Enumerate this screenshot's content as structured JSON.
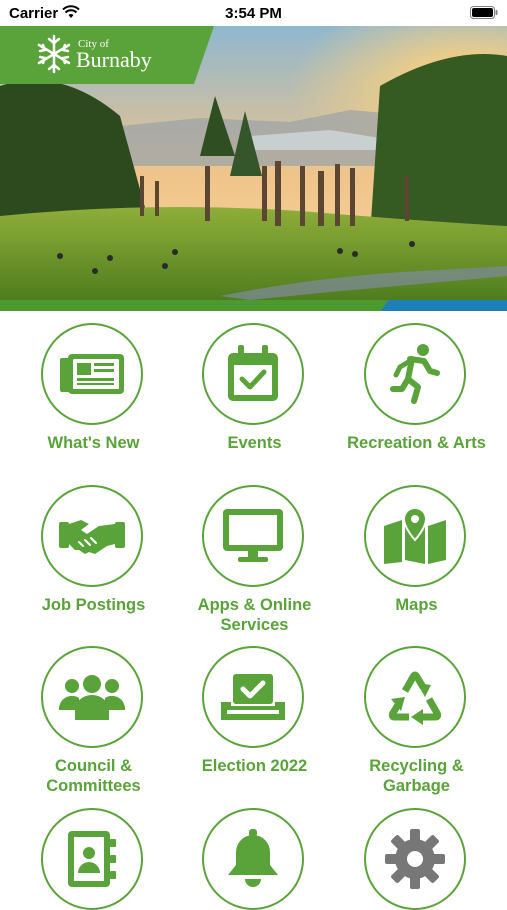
{
  "status_bar": {
    "carrier": "Carrier",
    "time": "3:54 PM"
  },
  "brand": {
    "city_of": "City of",
    "name": "Burnaby",
    "colors": {
      "green": "#5aa33a",
      "blue": "#1c7fb8"
    }
  },
  "tiles": [
    {
      "label": "What's New",
      "icon": "newspaper-icon"
    },
    {
      "label": "Events",
      "icon": "calendar-check-icon"
    },
    {
      "label": "Recreation & Arts",
      "icon": "running-person-icon"
    },
    {
      "label": "Job Postings",
      "icon": "handshake-icon"
    },
    {
      "label": "Apps & Online Services",
      "icon": "monitor-icon"
    },
    {
      "label": "Maps",
      "icon": "map-icon"
    },
    {
      "label": "Council & Committees",
      "icon": "people-group-icon"
    },
    {
      "label": "Election 2022",
      "icon": "ballot-box-icon"
    },
    {
      "label": "Recycling & Garbage",
      "icon": "recycle-icon"
    },
    {
      "label": "",
      "icon": "contact-book-icon"
    },
    {
      "label": "",
      "icon": "bell-icon"
    },
    {
      "label": "",
      "icon": "gear-icon"
    }
  ]
}
